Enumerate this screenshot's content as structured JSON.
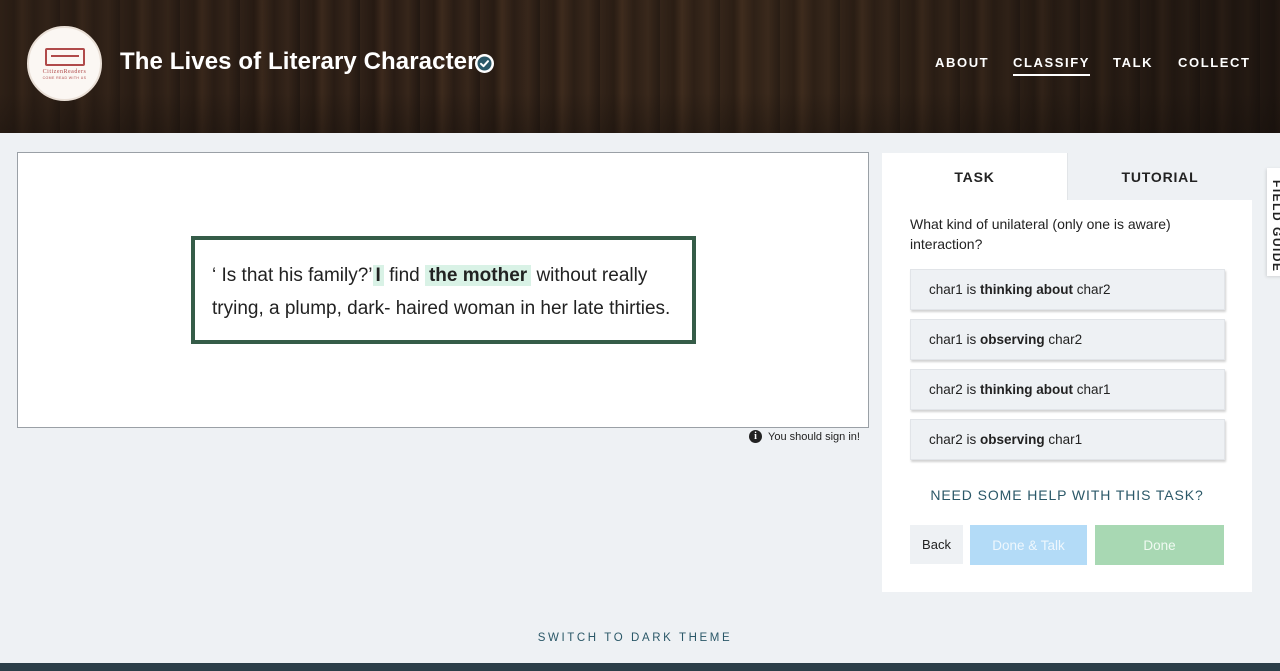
{
  "header": {
    "logo": {
      "text": "CitizenReaders",
      "subtext": "COME READ WITH US"
    },
    "title": "The Lives of Literary Characters",
    "verified_icon": "check-circle-icon",
    "nav": [
      "ABOUT",
      "CLASSIFY",
      "TALK",
      "COLLECT"
    ],
    "active_nav": "CLASSIFY"
  },
  "subject": {
    "segments": [
      {
        "text": "‘ Is that his family?’",
        "style": "plain"
      },
      {
        "text": "I",
        "style": "highlight-bold"
      },
      {
        "text": "find",
        "style": "plain"
      },
      {
        "text": "the mother",
        "style": "highlight-bold"
      },
      {
        "text": "without really trying, a plump, dark- haired woman in her late thirties.",
        "style": "plain"
      }
    ]
  },
  "signin_notice": {
    "icon": "info-icon",
    "text": "You should sign in!"
  },
  "task_panel": {
    "tabs": [
      "TASK",
      "TUTORIAL"
    ],
    "active_tab": "TASK",
    "question": "What kind of unilateral (only one is aware) interaction?",
    "answers": [
      {
        "pre": "char1 is",
        "bold": "thinking about",
        "post": "char2"
      },
      {
        "pre": "char1 is",
        "bold": "observing",
        "post": "char2"
      },
      {
        "pre": "char2 is",
        "bold": "thinking about",
        "post": "char1"
      },
      {
        "pre": "char2 is",
        "bold": "observing",
        "post": "char1"
      }
    ],
    "help_link": "NEED SOME HELP WITH THIS TASK?",
    "buttons": {
      "back": "Back",
      "done_talk": "Done & Talk",
      "done": "Done"
    }
  },
  "field_guide": "FIELD GUIDE",
  "theme_switch": "SWITCH TO DARK THEME",
  "colors": {
    "page_bg": "#eef1f4",
    "passage_border": "#355c48",
    "highlight": "#d9f2e6",
    "link": "#2b5868",
    "done_talk_disabled": "#b3dbf7",
    "done_disabled": "#a8d8b3"
  }
}
